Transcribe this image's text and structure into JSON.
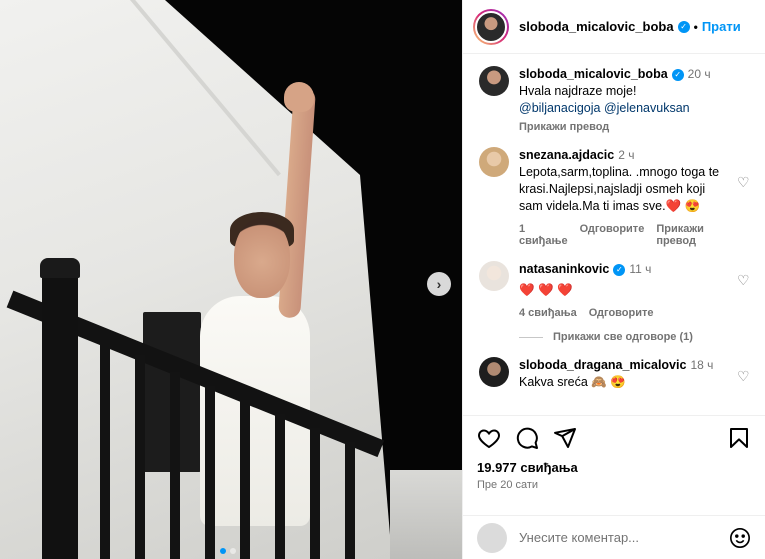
{
  "header": {
    "username": "sloboda_micalovic_boba",
    "verified_icon": "verified-badge-icon",
    "separator": "•",
    "follow_label": "Прати"
  },
  "comments": [
    {
      "username": "sloboda_micalovic_boba",
      "verified": true,
      "time": "20 ч",
      "text": "Hvala najdraze moje!",
      "mentions": "@biljanacigoja @jelenavuksan",
      "see_translation": "Прикажи превод"
    },
    {
      "username": "snezana.ajdacic",
      "verified": false,
      "time": "2 ч",
      "text": "Lepota,sarm,toplina. .mnogo toga te krasi.Najlepsi,najsladji osmeh koji sam videla.Ma ti imas sve.❤️ 😍",
      "likes": "1 свиђање",
      "reply": "Одговорите",
      "see_translation": "Прикажи превод"
    },
    {
      "username": "natasaninkovic",
      "verified": true,
      "time": "11 ч",
      "text": "❤️ ❤️ ❤️",
      "likes": "4 свиђања",
      "reply": "Одговорите",
      "view_replies": "Прикажи све одговоре (1)"
    },
    {
      "username": "sloboda_dragana_micalovic",
      "verified": false,
      "time": "18 ч",
      "text": "Kakva sreća 🙈 😍"
    }
  ],
  "actions": {
    "like_icon": "heart-icon",
    "comment_icon": "comment-icon",
    "share_icon": "send-icon",
    "save_icon": "bookmark-icon"
  },
  "likes_count": "19.977 свиђања",
  "posted_ago": "Пре 20 сати",
  "add_comment": {
    "placeholder": "Унесите коментар...",
    "emoji_icon": "emoji-icon"
  },
  "photo": {
    "next_icon": "chevron-right-icon",
    "carousel_dots": 2,
    "active_dot": 0
  },
  "colors": {
    "accent": "#0095f6",
    "secondary_text": "#737373",
    "border": "#efefef"
  }
}
